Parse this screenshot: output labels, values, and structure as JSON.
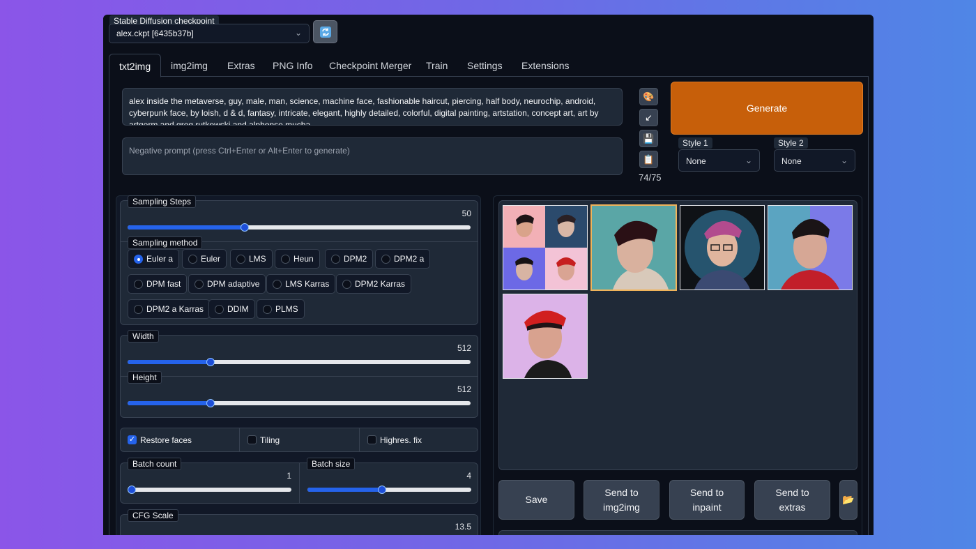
{
  "checkpoint": {
    "label": "Stable Diffusion checkpoint",
    "value": "alex.ckpt [6435b37b]"
  },
  "tabs": [
    "txt2img",
    "img2img",
    "Extras",
    "PNG Info",
    "Checkpoint Merger",
    "Train",
    "Settings",
    "Extensions"
  ],
  "prompt": {
    "value": "alex inside the metaverse, guy, male, man, science, machine face, fashionable haircut, piercing, half body, neurochip, android, cyberpunk face, by loish, d & d, fantasy, intricate, elegant, highly detailed, colorful, digital painting, artstation, concept art, art by artgerm and greg rutkowski and alphonse mucha",
    "negative_placeholder": "Negative prompt (press Ctrl+Enter or Alt+Enter to generate)",
    "token_count": "74/75"
  },
  "generate_label": "Generate",
  "styles": [
    {
      "label": "Style 1",
      "value": "None"
    },
    {
      "label": "Style 2",
      "value": "None"
    }
  ],
  "sampling_steps": {
    "label": "Sampling Steps",
    "value": "50",
    "fraction": 0.33
  },
  "sampling_method": {
    "label": "Sampling method",
    "selected": "Euler a",
    "options": [
      "Euler a",
      "Euler",
      "LMS",
      "Heun",
      "DPM2",
      "DPM2 a",
      "DPM fast",
      "DPM adaptive",
      "LMS Karras",
      "DPM2 Karras",
      "DPM2 a Karras",
      "DDIM",
      "PLMS"
    ]
  },
  "width": {
    "label": "Width",
    "value": "512",
    "fraction": 0.23
  },
  "height": {
    "label": "Height",
    "value": "512",
    "fraction": 0.23
  },
  "checks": {
    "restore_faces": "Restore faces",
    "tiling": "Tiling",
    "highres_fix": "Highres. fix"
  },
  "batch_count": {
    "label": "Batch count",
    "value": "1",
    "fraction": 0.0
  },
  "batch_size": {
    "label": "Batch size",
    "value": "4",
    "fraction": 0.43
  },
  "cfg_scale": {
    "label": "CFG Scale",
    "value": "13.5"
  },
  "actions": {
    "save": "Save",
    "send_img2img": "Send to img2img",
    "send_inpaint": "Send to inpaint",
    "send_extras": "Send to extras"
  },
  "colors": {
    "generate": "#c75f0a",
    "accent": "#2563eb",
    "selected_border": "#f0b35a"
  }
}
